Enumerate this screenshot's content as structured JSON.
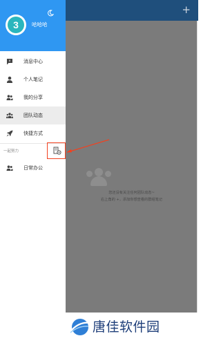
{
  "header": {
    "avatar_initial": "3",
    "username": "哈哈哈"
  },
  "menu": {
    "items": [
      {
        "label": "消息中心",
        "icon": "message-icon"
      },
      {
        "label": "个人笔记",
        "icon": "person-icon"
      },
      {
        "label": "我的分享",
        "icon": "share-users-icon"
      },
      {
        "label": "团队动态",
        "icon": "team-icon",
        "active": true
      },
      {
        "label": "快捷方式",
        "icon": "rocket-icon"
      }
    ],
    "section_label": "一起努力",
    "section_items": [
      {
        "label": "日常办公",
        "icon": "office-users-icon"
      }
    ]
  },
  "background": {
    "toolbar_action": "+",
    "empty_line1": "您还没有关注任何团队动态~",
    "empty_line2": "右上角的 +，添加你想查看的群组笔记"
  },
  "footer": {
    "brand": "唐佳软件园"
  },
  "colors": {
    "header_blue": "#2f97f2",
    "avatar_teal": "#2bb6bd",
    "highlight_red": "#f2411f",
    "toolbar_navy": "#1f4f7c"
  }
}
